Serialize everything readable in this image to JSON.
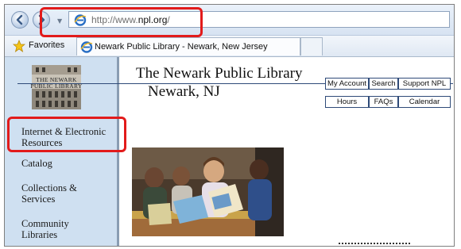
{
  "browser": {
    "url_prefix": "http://www.",
    "url_domain": "npl.org",
    "url_suffix": "/",
    "favorites_label": "Favorites",
    "tab_title": "Newark Public Library - Newark, New Jersey"
  },
  "site": {
    "logo_line1": "THE NEWARK",
    "logo_line2": "PUBLIC LIBRARY",
    "title": "The Newark Public Library",
    "subtitle": "Newark, NJ",
    "top_buttons": [
      "My Account",
      "Search",
      "Support NPL"
    ],
    "bottom_buttons": [
      "Hours",
      "FAQs",
      "Calendar"
    ],
    "nav_items": [
      {
        "line1": "Internet & Electronic",
        "line2": "Resources"
      },
      {
        "line1": "Catalog",
        "line2": ""
      },
      {
        "line1": "Collections &",
        "line2": "Services"
      },
      {
        "line1": "Community",
        "line2": "Libraries"
      }
    ]
  },
  "colors": {
    "highlight": "#e21b1b",
    "sidebar_bg": "#cfe0f1",
    "header_rule": "#2e4a78"
  },
  "icons": [
    "back-icon",
    "forward-icon",
    "ie-icon",
    "favorites-star-icon"
  ]
}
